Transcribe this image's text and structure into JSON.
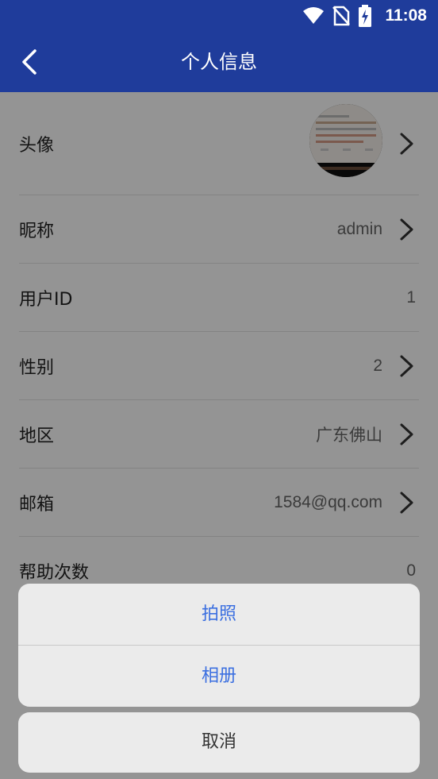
{
  "status_bar": {
    "time": "11:08",
    "icons": [
      "wifi-icon",
      "no-sim-icon",
      "battery-charging-icon"
    ]
  },
  "app_bar": {
    "title": "个人信息",
    "back_icon": "chevron-left-icon"
  },
  "profile": {
    "avatar_label": "头像",
    "rows": [
      {
        "label": "昵称",
        "value": "admin",
        "arrow": true
      },
      {
        "label": "用户ID",
        "value": "1",
        "arrow": false
      },
      {
        "label": "性别",
        "value": "2",
        "arrow": true
      },
      {
        "label": "地区",
        "value": "广东佛山",
        "arrow": true
      },
      {
        "label": "邮箱",
        "value": "1584@qq.com",
        "arrow": true
      },
      {
        "label": "帮助次数",
        "value": "0",
        "arrow": false
      }
    ]
  },
  "action_sheet": {
    "options": [
      "拍照",
      "相册"
    ],
    "cancel": "取消"
  },
  "colors": {
    "app_bar": "#1f3c9b",
    "option_text": "#3b6fe0",
    "sheet_bg": "#ebebeb",
    "overlay": "rgba(0,0,0,0.42)"
  }
}
